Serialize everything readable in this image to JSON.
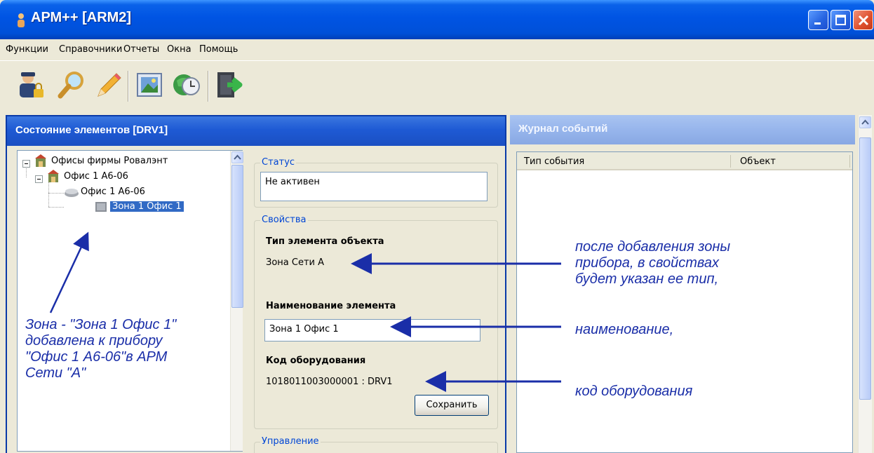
{
  "window": {
    "title": "АРМ++ [ARM2]",
    "controls": {
      "minimize": "minimize-icon",
      "maximize": "maximize-icon",
      "close": "close-icon"
    }
  },
  "menu": {
    "items": [
      "Функции",
      "Справочники",
      "Отчеты",
      "Окна",
      "Помощь"
    ]
  },
  "toolbar": {
    "icons": [
      "user-lock-icon",
      "search-icon",
      "edit-pencil-icon",
      "picture-icon",
      "globe-clock-icon",
      "exit-icon"
    ]
  },
  "left_panel": {
    "title": "Состояние элементов [DRV1]",
    "tree": {
      "root": "Офисы фирмы Ровалэнт",
      "child": "Офис 1 А6-06",
      "device": "Офис 1 А6-06",
      "zone": "Зона 1 Офис 1"
    },
    "status": {
      "group_title": "Статус",
      "value": "Не активен"
    },
    "properties": {
      "group_title": "Свойства",
      "type_label": "Тип элемента объекта",
      "type_value": "Зона Сети А",
      "name_label": "Наименование элемента",
      "name_value": "Зона 1 Офис 1",
      "code_label": "Код оборудования",
      "code_value": "1018011003000001 : DRV1",
      "save_button": "Сохранить"
    },
    "control": {
      "group_title": "Управление"
    }
  },
  "right_panel": {
    "title": "Журнал событий",
    "columns": [
      "Тип события",
      "Объект"
    ]
  },
  "annotations": {
    "left_note": [
      "Зона - \"Зона 1 Офис 1\"",
      "добавлена к прибору",
      "\"Офис 1 А6-06\"в АРМ",
      "Сети \"А\""
    ],
    "type_note": [
      "после добавления зоны",
      "прибора, в свойствах",
      "будет указан ее тип,"
    ],
    "name_note": "наименование,",
    "code_note": "код оборудования"
  },
  "colors": {
    "titlebar": "#0054e3",
    "panel_header": "#1e5ad4",
    "annotation": "#1a2ea8",
    "selection": "#316ac5"
  }
}
